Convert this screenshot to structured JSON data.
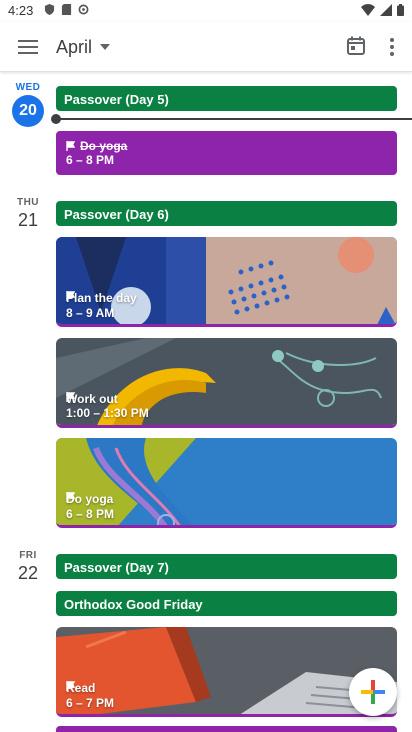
{
  "status_bar": {
    "time": "4:23"
  },
  "app_bar": {
    "menu_icon": "hamburger-menu-icon",
    "month_label": "April",
    "today_icon": "calendar-today-icon",
    "more_icon": "more-vert-icon"
  },
  "days": [
    {
      "weekday": "WED",
      "date": "20",
      "is_today": true
    },
    {
      "weekday": "THU",
      "date": "21",
      "is_today": false
    },
    {
      "weekday": "FRI",
      "date": "22",
      "is_today": false
    }
  ],
  "events": {
    "wed": [
      {
        "title": "Passover (Day 5)",
        "color": "#0b8043",
        "type": "all-day"
      },
      {
        "title": "Do yoga",
        "time": "6 – 8 PM",
        "color": "#8e24aa",
        "completed": true
      }
    ],
    "thu": [
      {
        "title": "Passover (Day 6)",
        "color": "#0b8043",
        "type": "all-day"
      },
      {
        "title": "Plan the day",
        "time": "8 – 9 AM",
        "image": "planner-illustration"
      },
      {
        "title": "Work out",
        "time": "1:00 – 1:30 PM",
        "image": "earphones-illustration"
      },
      {
        "title": "Do yoga",
        "time": "6 – 8 PM",
        "image": "yoga-mat-illustration"
      }
    ],
    "fri": [
      {
        "title": "Passover (Day 7)",
        "color": "#0b8043",
        "type": "all-day"
      },
      {
        "title": "Orthodox Good Friday",
        "color": "#0b8043",
        "type": "all-day"
      },
      {
        "title": "Read",
        "time": "6 – 7 PM",
        "image": "book-illustration"
      }
    ]
  },
  "fab": {
    "icon": "add-event-plus-icon"
  },
  "colors": {
    "accent": "#1a73e8",
    "holiday_green": "#0b8043",
    "task_purple": "#8e24aa"
  }
}
